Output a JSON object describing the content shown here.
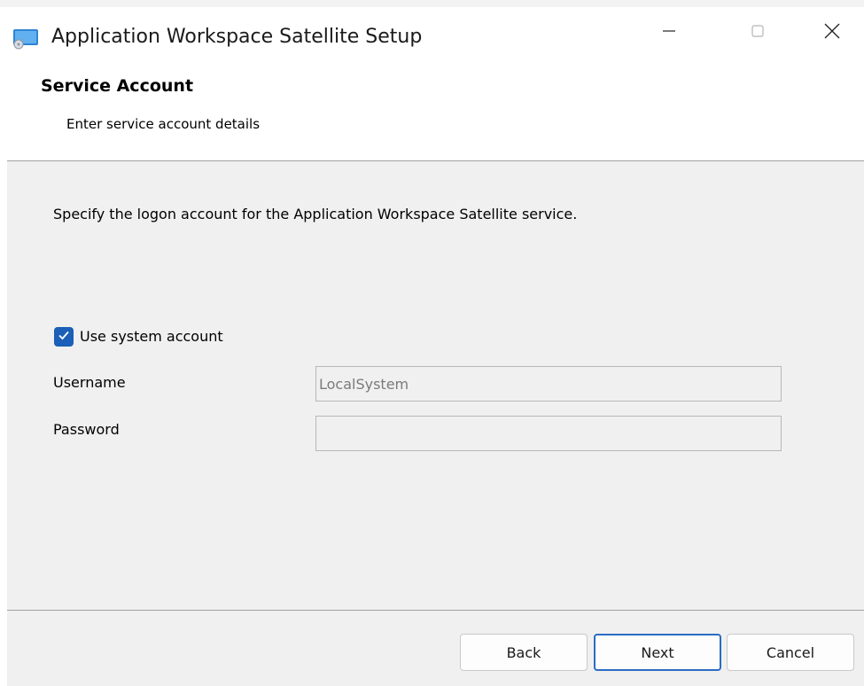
{
  "window": {
    "title": "Application Workspace Satellite Setup"
  },
  "header": {
    "title": "Service Account",
    "subtitle": "Enter service account details"
  },
  "content": {
    "instructions": "Specify the logon account for the Application Workspace Satellite service.",
    "use_system_account": {
      "label": "Use system account",
      "checked": true
    },
    "username": {
      "label": "Username",
      "value": "LocalSystem"
    },
    "password": {
      "label": "Password",
      "value": ""
    }
  },
  "buttons": {
    "back": "Back",
    "next": "Next",
    "cancel": "Cancel"
  },
  "colors": {
    "accent": "#1b5fb8",
    "panel_background": "#f0f0f0"
  },
  "icons": {
    "app": "installer-app-icon",
    "minimize": "minimize-icon",
    "maximize": "maximize-icon",
    "close": "close-icon",
    "check": "checkmark-icon"
  }
}
